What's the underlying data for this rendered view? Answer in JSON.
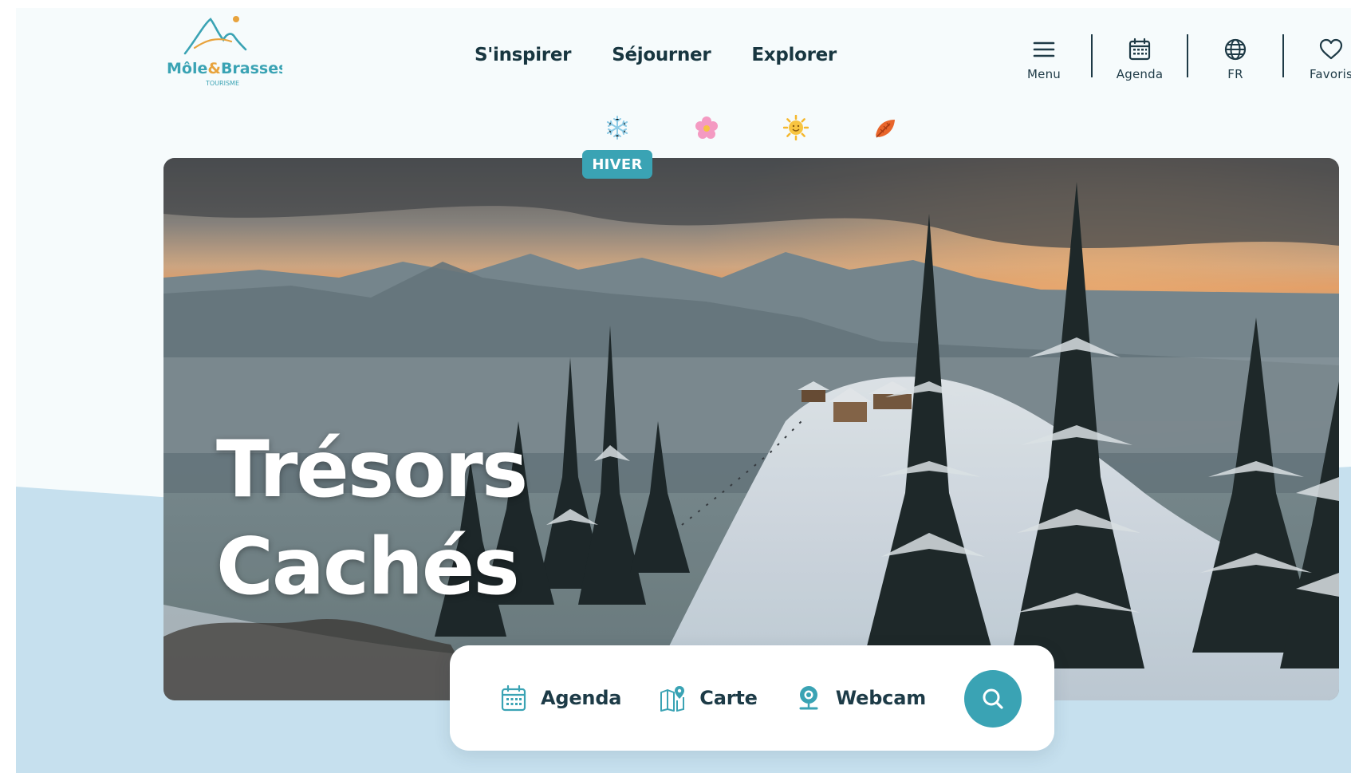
{
  "brand": {
    "name_part1": "Môle",
    "name_amp": "&",
    "name_part2": "Brasses",
    "tagline": "TOURISME",
    "colors": {
      "teal": "#3aa3b4",
      "orange": "#e8a33d",
      "navy": "#1e3a46"
    }
  },
  "main_nav": [
    {
      "label": "S'inspirer"
    },
    {
      "label": "Séjourner"
    },
    {
      "label": "Explorer"
    }
  ],
  "util_nav": [
    {
      "label": "Menu",
      "icon": "hamburger-icon"
    },
    {
      "label": "Agenda",
      "icon": "calendar-icon"
    },
    {
      "label": "FR",
      "icon": "globe-icon"
    },
    {
      "label": "Favoris",
      "icon": "heart-icon"
    }
  ],
  "seasons": {
    "items": [
      {
        "icon": "snowflake-icon"
      },
      {
        "icon": "flower-icon"
      },
      {
        "icon": "sun-icon"
      },
      {
        "icon": "autumn-leaf-icon"
      }
    ],
    "active_label": "HIVER"
  },
  "hero": {
    "title_line1": "Trésors",
    "title_line2": "Cachés",
    "image": "snowy-mountain-chalets-sunset"
  },
  "quick_access": {
    "items": [
      {
        "label": "Agenda",
        "icon": "calendar-icon"
      },
      {
        "label": "Carte",
        "icon": "map-pin-icon"
      },
      {
        "label": "Webcam",
        "icon": "webcam-icon"
      }
    ],
    "search_icon": "search-icon"
  },
  "colors": {
    "page_bg": "#f6fbfc",
    "wave": "#c6e0ee",
    "accent": "#3aa3b4"
  }
}
